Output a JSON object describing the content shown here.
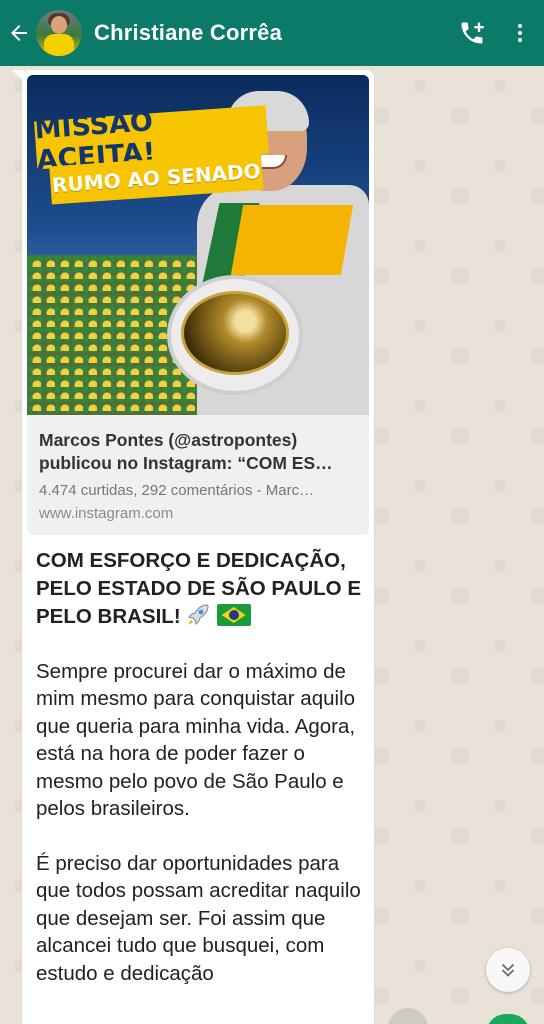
{
  "header": {
    "contact_name": "Christiane Corrêa",
    "back_icon": "arrow-left-icon",
    "call_icon": "add-call-icon",
    "menu_icon": "more-vert-icon",
    "color": "#0b7a69"
  },
  "message": {
    "link_preview": {
      "banner_line1": "MISSÃO ACEITA!",
      "banner_line2": "RUMO AO SENADO",
      "title_line1": "Marcos Pontes (@astropontes)",
      "title_line2": "publicou no Instagram: “COM ES…",
      "description": "4.474 curtidas, 292 comentários - Marc…",
      "url": "www.instagram.com"
    },
    "heading": "COM ESFORÇO E DEDICAÇÃO, PELO ESTADO DE SÃO PAULO E PELO BRASIL!",
    "paragraph1": "Sempre procurei dar o máximo de mim mesmo para conquistar aquilo que queria para minha vida. Agora, está na hora de poder fazer o mesmo pelo povo de São Paulo e pelos brasileiros.",
    "paragraph2": "É preciso dar oportunidades para que todos possam acreditar naquilo que desejam ser. Foi assim que alcancei tudo que busquei, com estudo e dedicação"
  },
  "scroll_button_icon": "double-chevron-down-icon"
}
